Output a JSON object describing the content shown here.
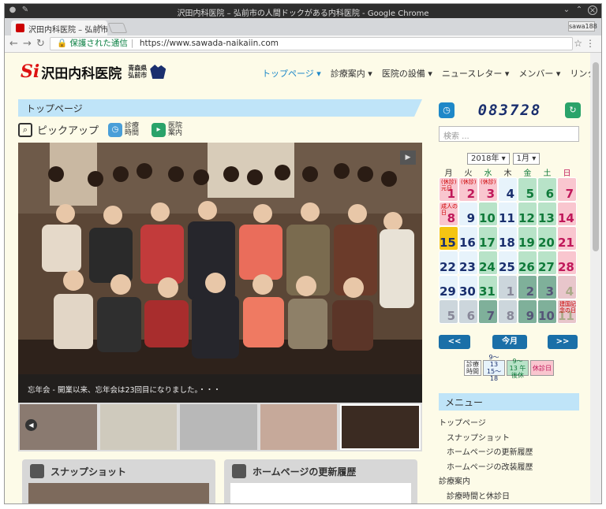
{
  "browser": {
    "window_title": "沢田内科医院 – 弘前市の人間ドックがある内科医院 - Google Chrome",
    "tab_title": "沢田内科医院 – 弘前市",
    "user_badge": "sawa188",
    "security_label": "保護された通信",
    "url": "https://www.sawada-naikaiin.com"
  },
  "site": {
    "logo_text": "沢田内科医院",
    "logo_pref_1": "青森県",
    "logo_pref_2": "弘前市",
    "nav": [
      {
        "label": "トップページ ▾"
      },
      {
        "label": "診療案内 ▾"
      },
      {
        "label": "医院の設備 ▾"
      },
      {
        "label": "ニュースレター ▾"
      },
      {
        "label": "メンバー ▾"
      },
      {
        "label": "リンク集"
      }
    ]
  },
  "main": {
    "section_title": "トップページ",
    "pickup_label": "ピックアップ",
    "quick_1": "診療時間",
    "quick_2": "医院案内",
    "slide_caption": "忘年会 - 開業以来、忘年会は23回目になりました。・・・",
    "card_1_title": "スナップショット",
    "card_2_title": "ホームページの更新履歴"
  },
  "sidebar": {
    "counter": "083728",
    "search_placeholder": "検索 ...",
    "year": "2018年 ▾",
    "month": "1月 ▾",
    "weekdays": [
      "月",
      "火",
      "水",
      "木",
      "金",
      "土",
      "日"
    ],
    "calendar": [
      {
        "d": "1",
        "t": "hol",
        "note": "(休診)元日"
      },
      {
        "d": "2",
        "t": "hol",
        "note": "(休診)"
      },
      {
        "d": "3",
        "t": "hol",
        "note": "(休診)"
      },
      {
        "d": "4",
        "t": "",
        "note": ""
      },
      {
        "d": "5",
        "t": "sat",
        "note": ""
      },
      {
        "d": "6",
        "t": "sat",
        "note": ""
      },
      {
        "d": "7",
        "t": "hol",
        "note": ""
      },
      {
        "d": "8",
        "t": "hol",
        "note": "成人の日"
      },
      {
        "d": "9",
        "t": "",
        "note": ""
      },
      {
        "d": "10",
        "t": "sat",
        "note": ""
      },
      {
        "d": "11",
        "t": "",
        "note": ""
      },
      {
        "d": "12",
        "t": "sat",
        "note": ""
      },
      {
        "d": "13",
        "t": "sat",
        "note": ""
      },
      {
        "d": "14",
        "t": "hol",
        "note": ""
      },
      {
        "d": "15",
        "t": "today",
        "note": ""
      },
      {
        "d": "16",
        "t": "",
        "note": ""
      },
      {
        "d": "17",
        "t": "sat",
        "note": ""
      },
      {
        "d": "18",
        "t": "",
        "note": ""
      },
      {
        "d": "19",
        "t": "sat",
        "note": ""
      },
      {
        "d": "20",
        "t": "sat",
        "note": ""
      },
      {
        "d": "21",
        "t": "hol",
        "note": ""
      },
      {
        "d": "22",
        "t": "",
        "note": ""
      },
      {
        "d": "23",
        "t": "",
        "note": ""
      },
      {
        "d": "24",
        "t": "sat",
        "note": ""
      },
      {
        "d": "25",
        "t": "",
        "note": ""
      },
      {
        "d": "26",
        "t": "sat",
        "note": ""
      },
      {
        "d": "27",
        "t": "sat",
        "note": ""
      },
      {
        "d": "28",
        "t": "hol",
        "note": ""
      },
      {
        "d": "29",
        "t": "",
        "note": ""
      },
      {
        "d": "30",
        "t": "",
        "note": ""
      },
      {
        "d": "31",
        "t": "sat",
        "note": ""
      },
      {
        "d": "1",
        "t": "other",
        "note": ""
      },
      {
        "d": "2",
        "t": "othersat",
        "note": ""
      },
      {
        "d": "3",
        "t": "othersat",
        "note": ""
      },
      {
        "d": "4",
        "t": "otherhol",
        "note": ""
      },
      {
        "d": "5",
        "t": "other",
        "note": ""
      },
      {
        "d": "6",
        "t": "other",
        "note": ""
      },
      {
        "d": "7",
        "t": "othersat",
        "note": ""
      },
      {
        "d": "8",
        "t": "other",
        "note": ""
      },
      {
        "d": "9",
        "t": "othersat",
        "note": ""
      },
      {
        "d": "10",
        "t": "othersat",
        "note": ""
      },
      {
        "d": "11",
        "t": "otherhol",
        "note": "建国記念の日"
      }
    ],
    "prev": "<<",
    "today_btn": "今月",
    "next": ">>",
    "legend_1": "診療時間",
    "legend_2": "9〜13 15〜18",
    "legend_3": "9〜13 午後休",
    "legend_4": "休診日",
    "menu_title": "メニュー",
    "menu": [
      {
        "label": "トップページ",
        "sub": false
      },
      {
        "label": "スナップショット",
        "sub": true
      },
      {
        "label": "ホームページの更新履歴",
        "sub": true
      },
      {
        "label": "ホームページの改装履歴",
        "sub": true
      },
      {
        "label": "診療案内",
        "sub": false
      },
      {
        "label": "診療時間と休診日",
        "sub": true
      }
    ]
  }
}
